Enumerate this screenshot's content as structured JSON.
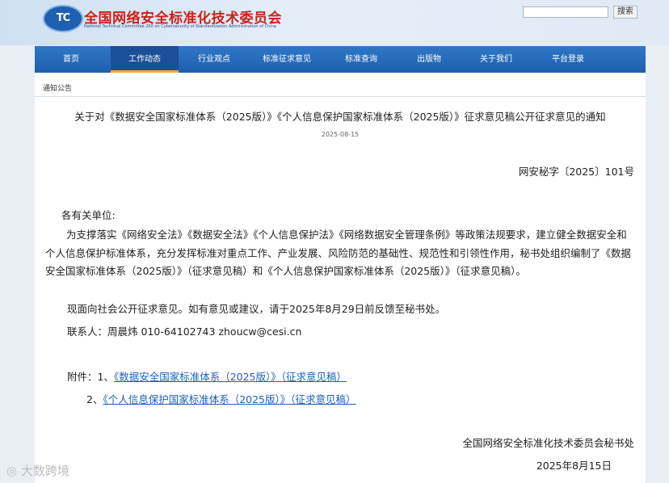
{
  "header": {
    "logo_text": "TC",
    "title": "全国网络安全标准化技术委员会",
    "subtitle": "National Technical Committee 260 on Cybersecurity of Standardization Administration of China",
    "search_placeholder": "",
    "search_button": "搜索"
  },
  "nav": {
    "items": [
      {
        "label": "首页"
      },
      {
        "label": "工作动态"
      },
      {
        "label": "行业观点"
      },
      {
        "label": "标准征求意见"
      },
      {
        "label": "标准查询"
      },
      {
        "label": "出版物"
      },
      {
        "label": "关于我们"
      },
      {
        "label": "平台登录"
      }
    ],
    "active": "工作动态"
  },
  "breadcrumb": "通知公告",
  "article": {
    "title": "关于对《数据安全国家标准体系（2025版）》《个人信息保护国家标准体系（2025版）》征求意见稿公开征求意见的通知",
    "date": "2025-08-15",
    "doc_number": "网安秘字〔2025〕101号",
    "salutation": "各有关单位:",
    "para1": "为支撑落实《网络安全法》《数据安全法》《个人信息保护法》《网络数据安全管理条例》等政策法规要求，建立健全数据安全和个人信息保护标准体系，充分发挥标准对重点工作、产业发展、风险防范的基础性、规范性和引领性作用，秘书处组织编制了《数据安全国家标准体系（2025版）》（征求意见稿）和《个人信息保护国家标准体系（2025版）》（征求意见稿）。",
    "para2": "现面向社会公开征求意见。如有意见或建议，请于2025年8月29日前反馈至秘书处。",
    "contact": "联系人：周晨炜  010-64102743  zhoucw@cesi.cn",
    "attachments_prefix": "附件：1、",
    "attachment1": "《数据安全国家标准体系（2025版）》（征求意见稿）",
    "attachment2_prefix": "2、",
    "attachment2": "《个人信息保护国家标准体系（2025版）》（征求意见稿）",
    "signature_org": "全国网络安全标准化技术委员会秘书处",
    "signature_date": "2025年8月15日"
  },
  "watermark": "大数跨境"
}
